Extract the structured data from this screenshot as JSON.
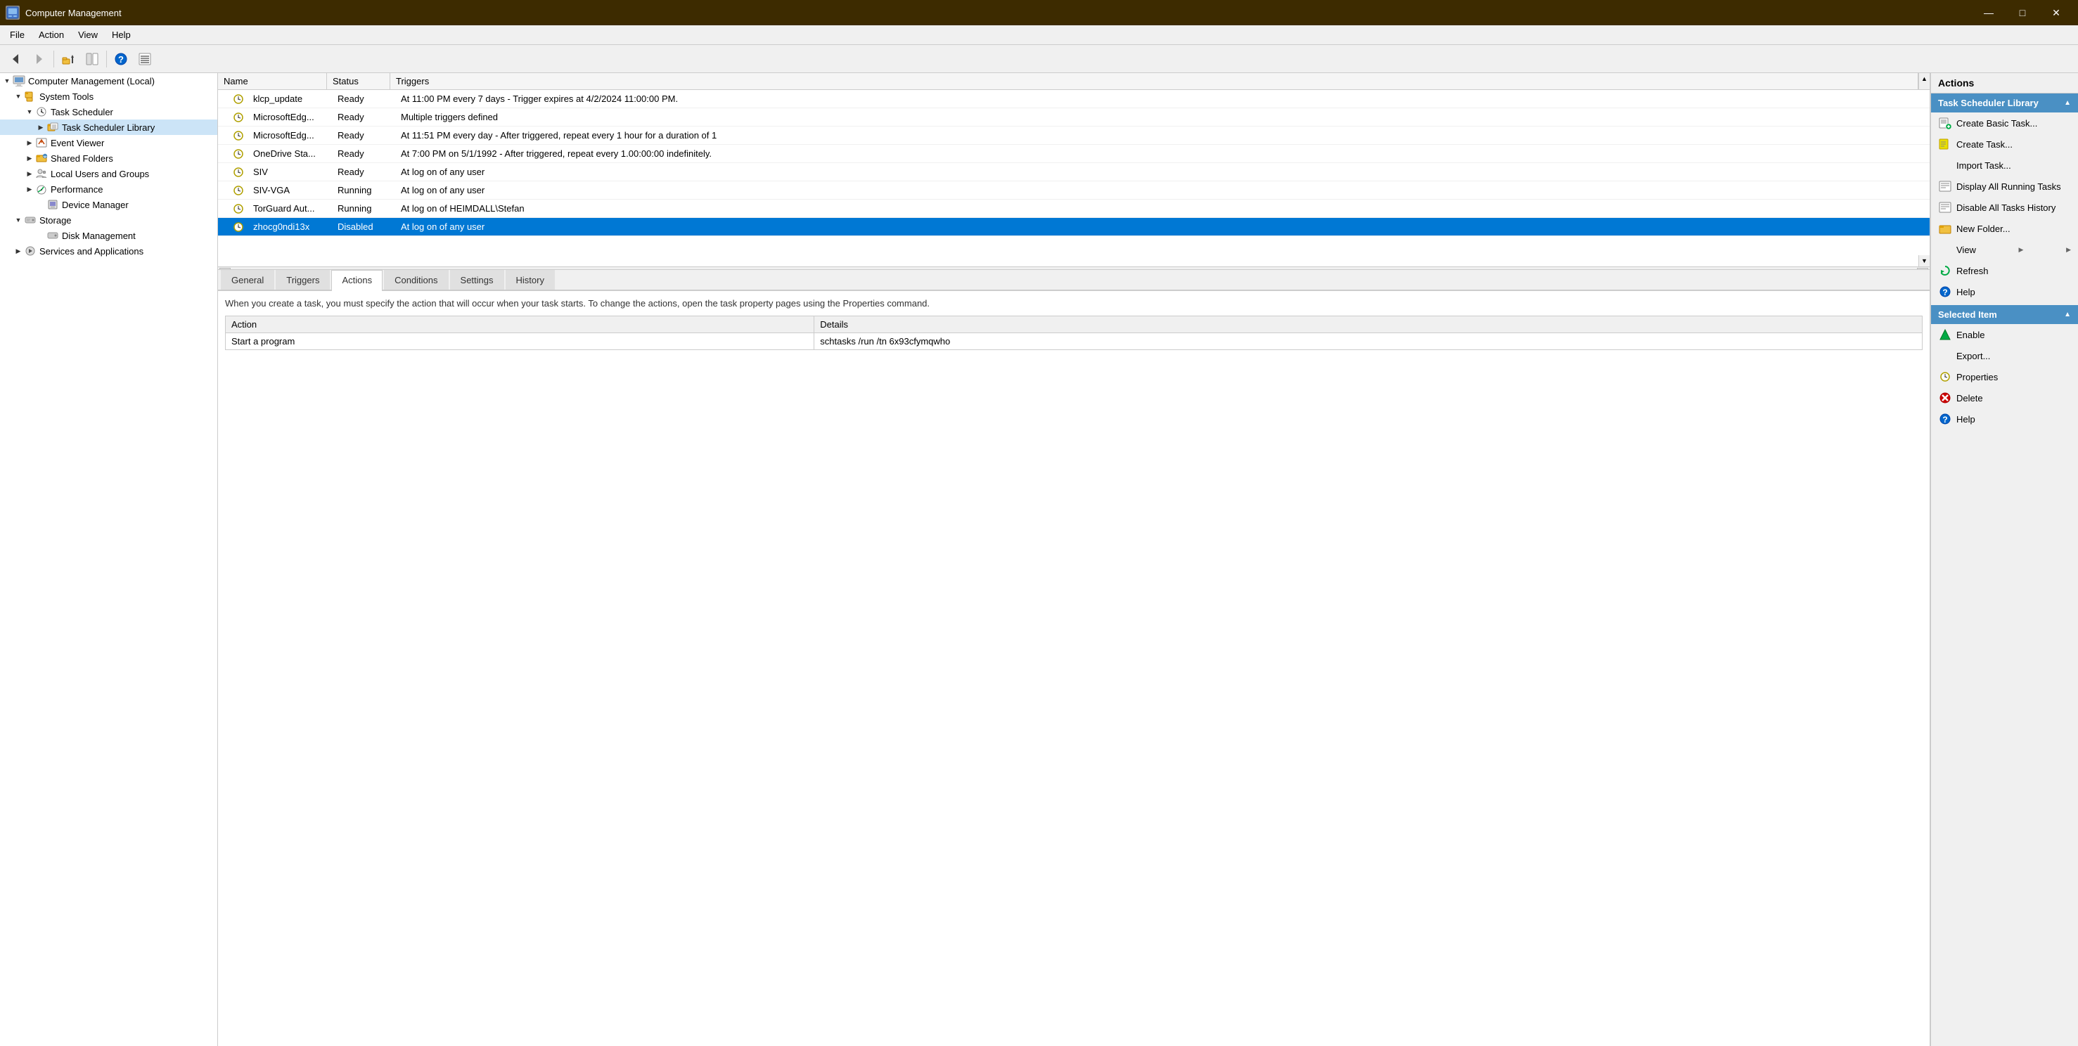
{
  "titleBar": {
    "title": "Computer Management",
    "minimize": "—",
    "maximize": "□",
    "close": "✕"
  },
  "menuBar": {
    "items": [
      "File",
      "Action",
      "View",
      "Help"
    ]
  },
  "toolbar": {
    "buttons": [
      {
        "name": "back-button",
        "icon": "◀",
        "label": "Back"
      },
      {
        "name": "forward-button",
        "icon": "▶",
        "label": "Forward"
      },
      {
        "name": "up-button",
        "icon": "📁",
        "label": "Up"
      },
      {
        "name": "show-hide-button",
        "icon": "⬛",
        "label": "Show/Hide"
      },
      {
        "name": "help-button",
        "icon": "❓",
        "label": "Help"
      },
      {
        "name": "export-button",
        "icon": "🗒",
        "label": "Export"
      }
    ]
  },
  "treePane": {
    "items": [
      {
        "id": "computer-management",
        "label": "Computer Management (Local)",
        "level": 0,
        "expanded": true,
        "hasChildren": true
      },
      {
        "id": "system-tools",
        "label": "System Tools",
        "level": 1,
        "expanded": true,
        "hasChildren": true
      },
      {
        "id": "task-scheduler",
        "label": "Task Scheduler",
        "level": 2,
        "expanded": true,
        "hasChildren": true
      },
      {
        "id": "task-scheduler-library",
        "label": "Task Scheduler Library",
        "level": 3,
        "expanded": false,
        "hasChildren": true,
        "selected": true
      },
      {
        "id": "event-viewer",
        "label": "Event Viewer",
        "level": 2,
        "expanded": false,
        "hasChildren": true
      },
      {
        "id": "shared-folders",
        "label": "Shared Folders",
        "level": 2,
        "expanded": false,
        "hasChildren": true
      },
      {
        "id": "local-users-groups",
        "label": "Local Users and Groups",
        "level": 2,
        "expanded": false,
        "hasChildren": true
      },
      {
        "id": "performance",
        "label": "Performance",
        "level": 2,
        "expanded": false,
        "hasChildren": true
      },
      {
        "id": "device-manager",
        "label": "Device Manager",
        "level": 2,
        "expanded": false,
        "hasChildren": false
      },
      {
        "id": "storage",
        "label": "Storage",
        "level": 1,
        "expanded": true,
        "hasChildren": true
      },
      {
        "id": "disk-management",
        "label": "Disk Management",
        "level": 2,
        "expanded": false,
        "hasChildren": false
      },
      {
        "id": "services-applications",
        "label": "Services and Applications",
        "level": 1,
        "expanded": false,
        "hasChildren": true
      }
    ]
  },
  "taskList": {
    "headers": [
      "Name",
      "Status",
      "Triggers"
    ],
    "rows": [
      {
        "name": "klcp_update",
        "status": "Ready",
        "triggers": "At 11:00 PM every 7 days - Trigger expires at 4/2/2024 11:00:00 PM.",
        "selected": false
      },
      {
        "name": "MicrosoftEdg...",
        "status": "Ready",
        "triggers": "Multiple triggers defined",
        "selected": false
      },
      {
        "name": "MicrosoftEdg...",
        "status": "Ready",
        "triggers": "At 11:51 PM every day - After triggered, repeat every 1 hour for a duration of 1",
        "selected": false
      },
      {
        "name": "OneDrive Sta...",
        "status": "Ready",
        "triggers": "At 7:00 PM on 5/1/1992 - After triggered, repeat every 1.00:00:00 indefinitely.",
        "selected": false
      },
      {
        "name": "SIV",
        "status": "Ready",
        "triggers": "At log on of any user",
        "selected": false
      },
      {
        "name": "SIV-VGA",
        "status": "Running",
        "triggers": "At log on of any user",
        "selected": false
      },
      {
        "name": "TorGuard Aut...",
        "status": "Running",
        "triggers": "At log on of HEIMDALL\\Stefan",
        "selected": false
      },
      {
        "name": "zhocg0ndi13x",
        "status": "Disabled",
        "triggers": "At log on of any user",
        "selected": true
      }
    ]
  },
  "detailsTabs": {
    "tabs": [
      "General",
      "Triggers",
      "Actions",
      "Conditions",
      "Settings",
      "History"
    ],
    "activeTab": "Actions"
  },
  "actionsTab": {
    "description": "When you create a task, you must specify the action that will occur when your task starts.  To change the actions, open the task property pages using the Properties command.",
    "tableHeaders": [
      "Action",
      "Details"
    ],
    "rows": [
      {
        "action": "Start a program",
        "details": "schtasks /run /tn 6x93cfymqwho"
      }
    ]
  },
  "actionsPane": {
    "taskSchedulerSection": {
      "header": "Task Scheduler Library",
      "items": [
        {
          "label": "Create Basic Task...",
          "icon": "📋",
          "iconName": "create-basic-task-icon"
        },
        {
          "label": "Create Task...",
          "icon": "📋",
          "iconName": "create-task-icon"
        },
        {
          "label": "Import Task...",
          "icon": "",
          "iconName": "import-task-icon"
        },
        {
          "label": "Display All Running Tasks",
          "icon": "🗒",
          "iconName": "display-running-tasks-icon"
        },
        {
          "label": "Disable All Tasks History",
          "icon": "🗒",
          "iconName": "disable-history-icon"
        },
        {
          "label": "New Folder...",
          "icon": "📁",
          "iconName": "new-folder-icon"
        },
        {
          "label": "View",
          "icon": "",
          "iconName": "view-icon",
          "submenu": true
        },
        {
          "label": "Refresh",
          "icon": "🔄",
          "iconName": "refresh-icon"
        },
        {
          "label": "Help",
          "icon": "❓",
          "iconName": "help-icon"
        }
      ]
    },
    "selectedItemSection": {
      "header": "Selected Item",
      "items": [
        {
          "label": "Enable",
          "icon": "✅",
          "iconName": "enable-icon"
        },
        {
          "label": "Export...",
          "icon": "",
          "iconName": "export-icon"
        },
        {
          "label": "Properties",
          "icon": "🕐",
          "iconName": "properties-icon"
        },
        {
          "label": "Delete",
          "icon": "❌",
          "iconName": "delete-icon"
        },
        {
          "label": "Help",
          "icon": "❓",
          "iconName": "help-icon-selected"
        }
      ]
    }
  }
}
